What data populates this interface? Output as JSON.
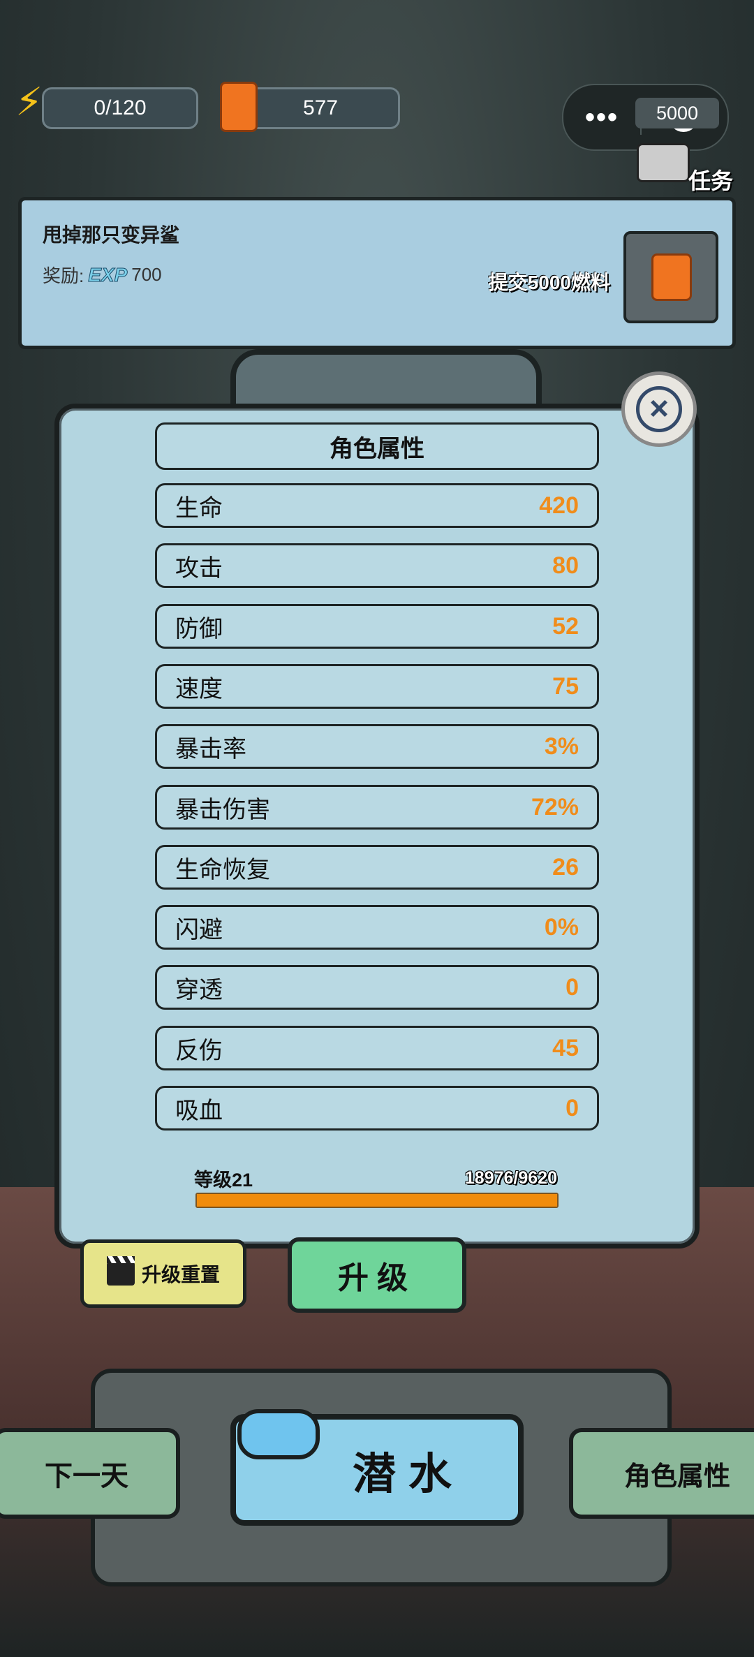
{
  "hud": {
    "energy": "0/120",
    "fuel": "577",
    "energy_icon": "lightning-icon",
    "fuel_icon": "fuel-can-icon"
  },
  "miniprogram": {
    "more": "•••"
  },
  "task_tag": "任务",
  "quest": {
    "title": "甩掉那只变异鲨",
    "reward_label": "奖励:",
    "reward_badge": "EXP",
    "reward_value": "700",
    "submit_text": "提交5000燃料",
    "item_count": "5000"
  },
  "panel": {
    "title": "角色属性",
    "close_icon": "×",
    "stats": [
      {
        "name": "生命",
        "value": "420"
      },
      {
        "name": "攻击",
        "value": "80"
      },
      {
        "name": "防御",
        "value": "52"
      },
      {
        "name": "速度",
        "value": "75"
      },
      {
        "name": "暴击率",
        "value": "3%"
      },
      {
        "name": "暴击伤害",
        "value": "72%"
      },
      {
        "name": "生命恢复",
        "value": "26"
      },
      {
        "name": "闪避",
        "value": "0%"
      },
      {
        "name": "穿透",
        "value": "0"
      },
      {
        "name": "反伤",
        "value": "45"
      },
      {
        "name": "吸血",
        "value": "0"
      }
    ],
    "level_label": "等级21",
    "level_exp": "18976/9620",
    "level_progress": 1.0,
    "reset_label": "升级重置",
    "upgrade_label": "升级"
  },
  "nav": {
    "next_day": "下一天",
    "dive": "潜水",
    "attributes": "角色属性"
  },
  "colors": {
    "stat_value": "#f08c1a",
    "progress": "#f08c0c",
    "upgrade_button": "#6fd59a",
    "dive_button": "#8fd0ea"
  }
}
